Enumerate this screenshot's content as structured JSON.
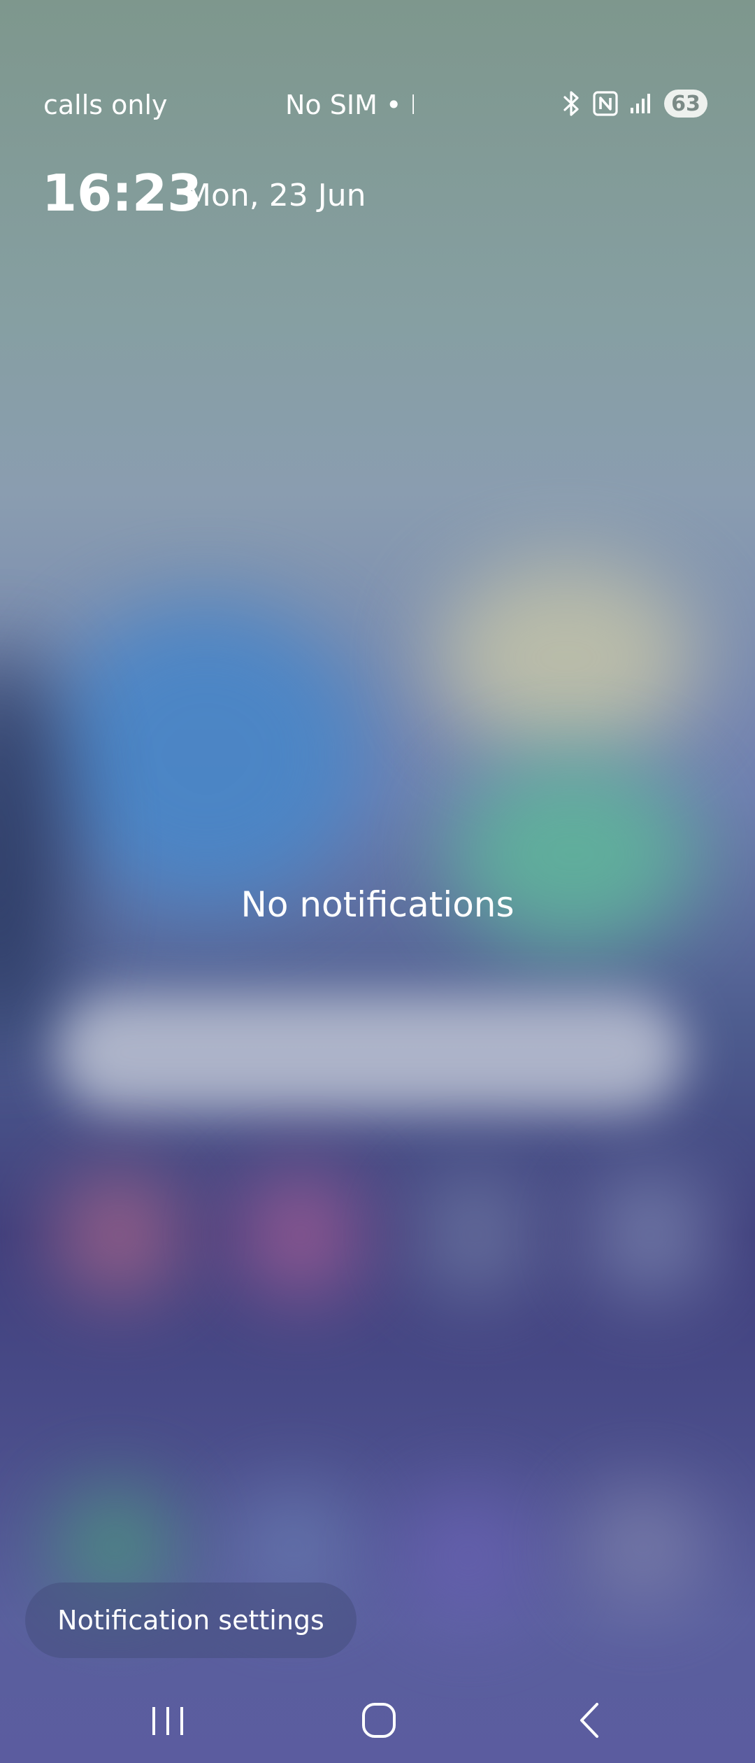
{
  "status_bar": {
    "left_text": "calls only",
    "center_text": "No SIM • E",
    "icons": [
      "bluetooth-icon",
      "nfc-icon",
      "signal-icon"
    ],
    "battery_level": "63"
  },
  "lockscreen": {
    "time": "16:23",
    "date": "Mon, 23 Jun"
  },
  "notifications": {
    "empty_message": "No notifications"
  },
  "footer": {
    "settings_button": "Notification settings"
  },
  "navigation": {
    "buttons": [
      "recent-apps-icon",
      "home-icon",
      "back-icon"
    ]
  },
  "colors": {
    "text": "#ffffff",
    "battery_pill": "#eef1ee"
  }
}
